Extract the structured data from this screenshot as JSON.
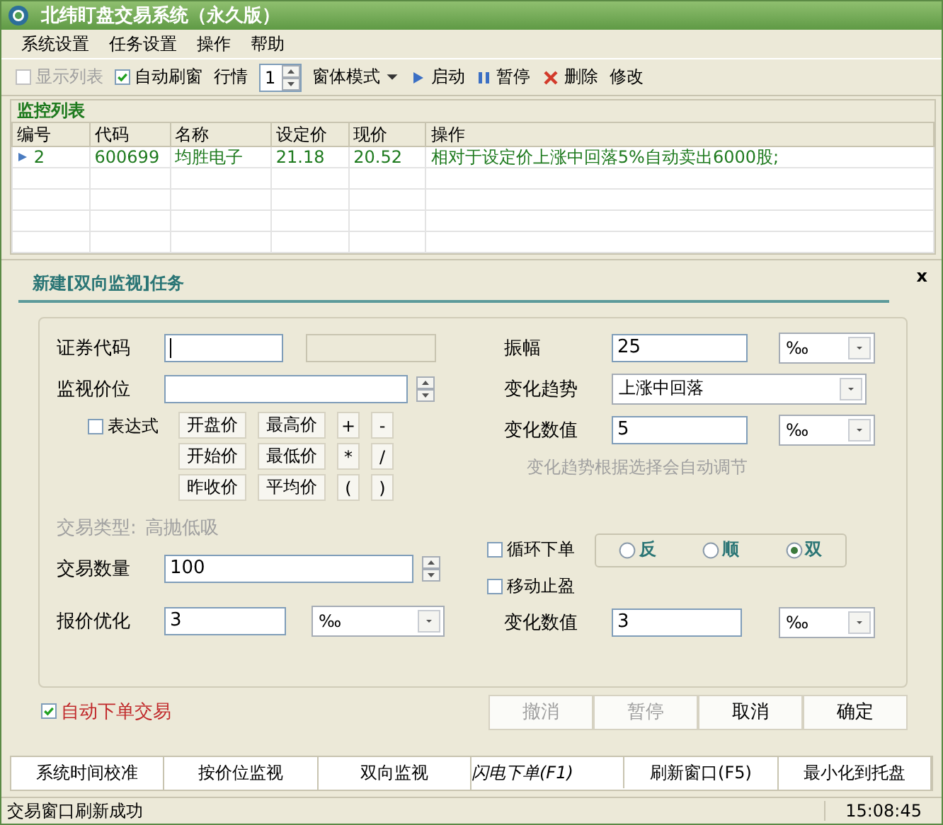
{
  "window": {
    "title": "北纬盯盘交易系统（永久版）"
  },
  "menu": [
    "系统设置",
    "任务设置",
    "操作",
    "帮助"
  ],
  "toolbar": {
    "show_list": {
      "label": "显示列表",
      "checked": false,
      "disabled": true
    },
    "auto_refresh": {
      "label": "自动刷窗",
      "checked": true
    },
    "quote_label": "行情",
    "quote_value": "1",
    "mode": "窗体模式",
    "buttons": [
      {
        "kind": "start",
        "label": "启动"
      },
      {
        "kind": "pause",
        "label": "暂停"
      },
      {
        "kind": "delete",
        "label": "删除"
      },
      {
        "kind": "edit",
        "label": "修改"
      }
    ]
  },
  "monitor": {
    "title": "监控列表",
    "columns": [
      "编号",
      "代码",
      "名称",
      "设定价",
      "现价",
      "操作"
    ],
    "rows": [
      {
        "cells": [
          "2",
          "600699",
          "均胜电子",
          "21.18",
          "20.52",
          "相对于设定价上涨中回落5%自动卖出6000股;"
        ]
      }
    ]
  },
  "form": {
    "title": "新建[双向监视]任务",
    "close": "x",
    "code": {
      "label": "证券代码"
    },
    "watch_price": {
      "label": "监视价位"
    },
    "expression": {
      "label": "表达式",
      "checked": false
    },
    "keys": [
      [
        "开盘价",
        "最高价",
        "+",
        "-"
      ],
      [
        "开始价",
        "最低价",
        "*",
        "/"
      ],
      [
        "昨收价",
        "平均价",
        "(",
        ")"
      ]
    ],
    "trade_type": {
      "label": "交易类型:",
      "value": "高抛低吸"
    },
    "quantity": {
      "label": "交易数量",
      "value": "100"
    },
    "price_opt": {
      "label": "报价优化",
      "value": "3",
      "unit": "‰"
    },
    "amplitude": {
      "label": "振幅",
      "value": "25",
      "unit": "‰"
    },
    "trend": {
      "label": "变化趋势",
      "value": "上涨中回落"
    },
    "change": {
      "label": "变化数值",
      "value": "5",
      "unit": "‰"
    },
    "hint": "变化趋势根据选择会自动调节",
    "loop": {
      "label": "循环下单",
      "checked": false
    },
    "directions": [
      {
        "label": "反",
        "selected": false
      },
      {
        "label": "顺",
        "selected": false
      },
      {
        "label": "双",
        "selected": true
      }
    ],
    "trailing": {
      "label": "移动止盈",
      "checked": false
    },
    "change2": {
      "label": "变化数值",
      "value": "3",
      "unit": "‰"
    },
    "auto_order": {
      "label": "自动下单交易",
      "checked": true
    },
    "buttons": [
      {
        "label": "撤消",
        "disabled": true
      },
      {
        "label": "暂停",
        "disabled": true
      },
      {
        "label": "取消",
        "disabled": false
      },
      {
        "label": "确定",
        "disabled": false
      }
    ]
  },
  "tabs": [
    {
      "label": "系统时间校准",
      "selected": false
    },
    {
      "label": "按价位监视",
      "selected": false
    },
    {
      "label": "双向监视",
      "selected": false
    },
    {
      "label": "闪电下单(F1)",
      "selected": true
    },
    {
      "label": "刷新窗口(F5)",
      "selected": false
    },
    {
      "label": "最小化到托盘",
      "selected": false
    }
  ],
  "status_bar": {
    "message": "交易窗口刷新成功",
    "time": "15:08:45"
  }
}
